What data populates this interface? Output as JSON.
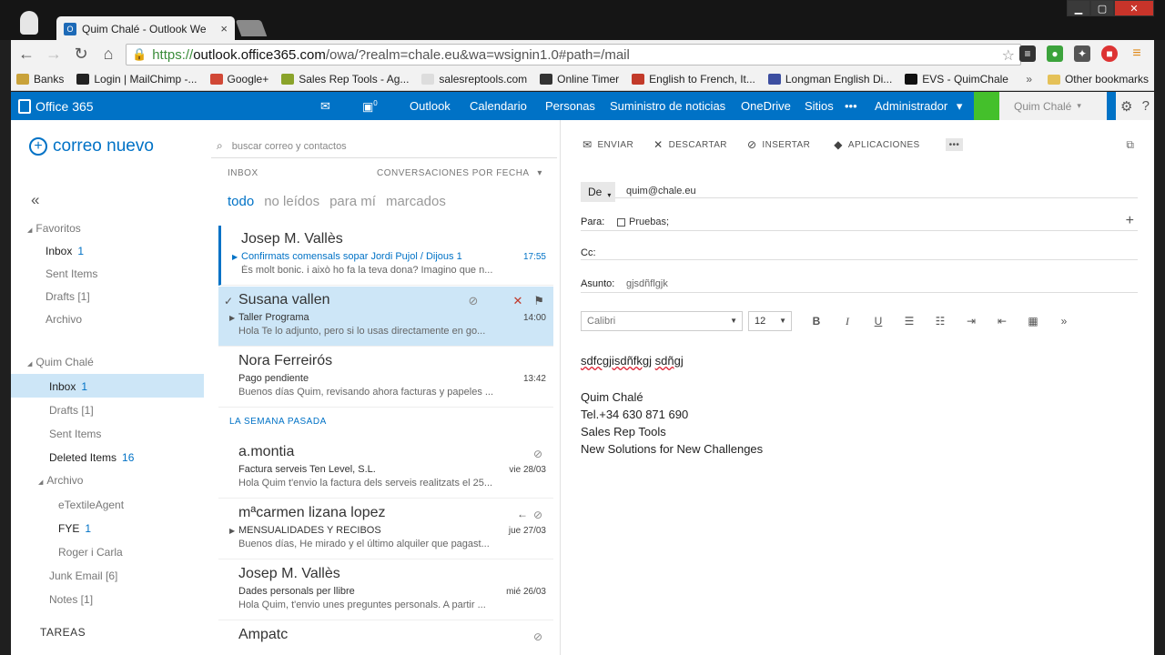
{
  "browser": {
    "tab_title": "Quim Chalé - Outlook We",
    "tab_close": "×",
    "url_scheme": "https://",
    "url_host": "outlook.office365.com",
    "url_path": "/owa/?realm=chale.eu&wa=wsignin1.0#path=/mail",
    "bookmarks": [
      {
        "label": "Banks",
        "color": "#c9a23a"
      },
      {
        "label": "Login | MailChimp -...",
        "color": "#222222"
      },
      {
        "label": "Google+",
        "color": "#d14836"
      },
      {
        "label": "Sales Rep Tools - Ag...",
        "color": "#8aa32a"
      },
      {
        "label": "salesreptools.com",
        "color": "#dddddd"
      },
      {
        "label": "Online Timer",
        "color": "#333333"
      },
      {
        "label": "English to French, It...",
        "color": "#c23a2a"
      },
      {
        "label": "Longman English Di...",
        "color": "#3c4ea0"
      },
      {
        "label": "EVS - QuimChale",
        "color": "#111111"
      }
    ],
    "bookmarks_more": "»",
    "other_bookmarks": "Other bookmarks"
  },
  "o365": {
    "brand": "Office 365",
    "nav": [
      "Outlook",
      "Calendario",
      "Personas",
      "Suministro de noticias",
      "OneDrive",
      "Sitios",
      "•••",
      "Administrador"
    ],
    "admin_caret": "▾",
    "user": "Quim Chalé",
    "accent": "#0072c6"
  },
  "leftnav": {
    "new_mail": "correo nuevo",
    "collapse": "«",
    "favorites_label": "Favoritos",
    "favorites": [
      {
        "label": "Inbox",
        "count": "1",
        "bold": true
      },
      {
        "label": "Sent Items",
        "count": ""
      },
      {
        "label": "Drafts [1]",
        "count": ""
      },
      {
        "label": "Archivo",
        "count": ""
      }
    ],
    "account_label": "Quim Chalé",
    "folders": [
      {
        "label": "Inbox",
        "count": "1"
      },
      {
        "label": "Drafts [1]",
        "count": ""
      },
      {
        "label": "Sent Items",
        "count": ""
      },
      {
        "label": "Deleted Items",
        "count": "16"
      },
      {
        "label": "Archivo",
        "count": ""
      },
      {
        "label": "eTextileAgent",
        "count": ""
      },
      {
        "label": "FYE",
        "count": "1"
      },
      {
        "label": "Roger i Carla",
        "count": ""
      },
      {
        "label": "Junk Email [6]",
        "count": ""
      },
      {
        "label": "Notes [1]",
        "count": ""
      }
    ],
    "tasks": "TAREAS"
  },
  "msglist": {
    "search_placeholder": "buscar correo y contactos",
    "folder": "INBOX",
    "sort": "CONVERSACIONES POR FECHA",
    "sort_caret": "▾",
    "filters": [
      "todo",
      "no leídos",
      "para mí",
      "marcados"
    ],
    "last_week": "LA SEMANA PASADA",
    "messages": [
      {
        "sender": "Josep M. Vallès",
        "subject": "Confirmats comensals sopar Jordi Pujol / Dijous 1",
        "preview": "És molt bonic. i això ho fa la teva dona? Imagino que n...",
        "date": "17:55"
      },
      {
        "sender": "Susana vallen",
        "subject": "Taller Programa",
        "preview": "Hola  Te lo adjunto, pero si lo usas directamente en go...",
        "date": "14:00"
      },
      {
        "sender": "Nora Ferreirós",
        "subject": "Pago pendiente",
        "preview": "Buenos días Quim,  revisando ahora facturas y papeles ...",
        "date": "13:42"
      },
      {
        "sender": "a.montia",
        "subject": "Factura serveis Ten Level, S.L.",
        "preview": "Hola Quim t'envio la factura dels serveis realitzats el 25...",
        "date": "vie 28/03"
      },
      {
        "sender": "mªcarmen lizana lopez",
        "subject": "MENSUALIDADES Y RECIBOS",
        "preview": "Buenos días,  He mirado y el último alquiler que pagast...",
        "date": "jue 27/03"
      },
      {
        "sender": "Josep M. Vallès",
        "subject": "Dades personals per llibre",
        "preview": "Hola Quim,  t'envio unes preguntes personals. A partir ...",
        "date": "mié 26/03"
      },
      {
        "sender": "Ampatc",
        "subject": "",
        "preview": "",
        "date": ""
      }
    ]
  },
  "compose": {
    "cmds": [
      "ENVIAR",
      "DESCARTAR",
      "INSERTAR",
      "APLICACIONES",
      "•••"
    ],
    "from_btn": "De",
    "from_value": "quim@chale.eu",
    "to_label": "Para:",
    "to_value": "Pruebas;",
    "cc_label": "Cc:",
    "subject_label": "Asunto:",
    "subject_value": "gjsdñflgjk",
    "font": "Calibri",
    "size": "12",
    "body_line1a": "sdfcgjisdñfkgj",
    "body_line1b": "sdñgj",
    "signature": [
      "Quim Chalé",
      "Tel.+34 630 871 690",
      "Sales Rep Tools",
      "New Solutions for New Challenges"
    ]
  }
}
